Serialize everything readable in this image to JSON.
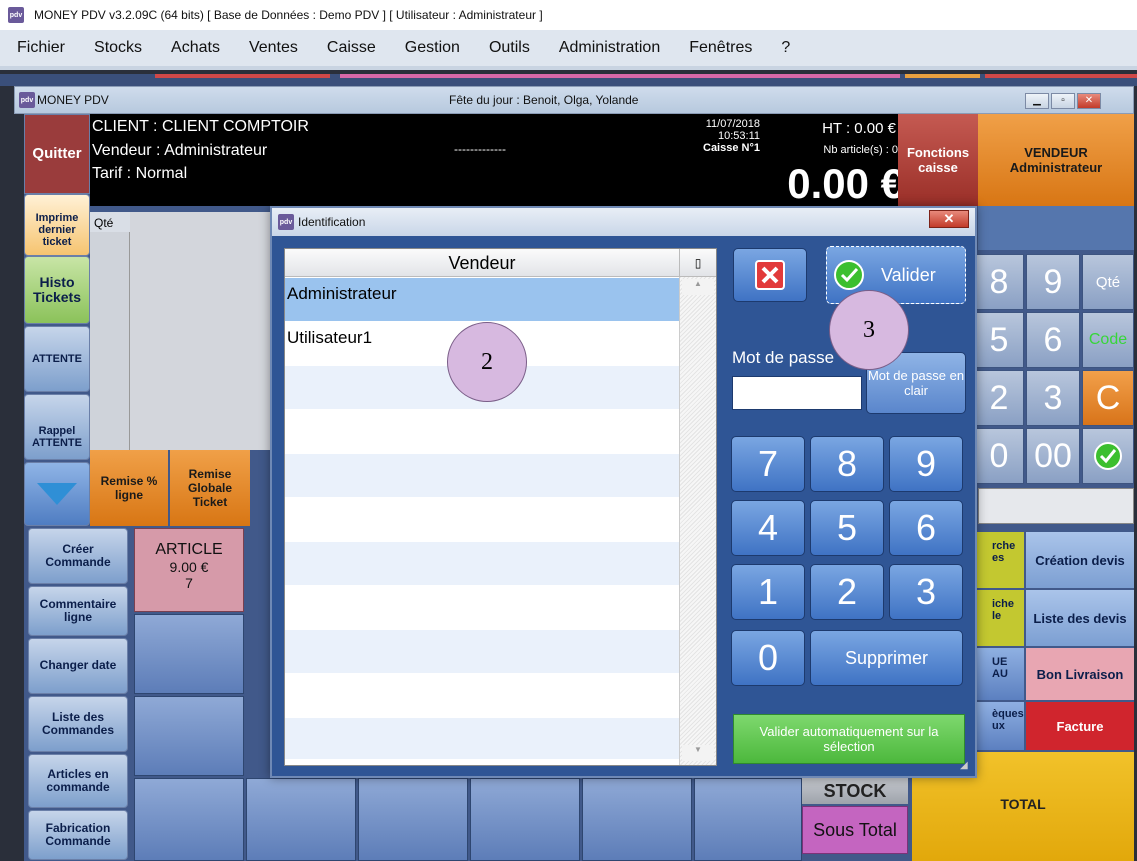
{
  "titlebar": {
    "text": "MONEY PDV v3.2.09C (64 bits) [ Base de Données : Demo PDV ] [ Utilisateur : Administrateur ]"
  },
  "menu": [
    "Fichier",
    "Stocks",
    "Achats",
    "Ventes",
    "Caisse",
    "Gestion",
    "Outils",
    "Administration",
    "Fenêtres",
    "?"
  ],
  "inner_window": {
    "title": "MONEY PDV",
    "fete": "Fête du jour : Benoit, Olga, Yolande"
  },
  "header": {
    "client": "CLIENT : CLIENT COMPTOIR",
    "vendeur": "Vendeur : Administrateur",
    "tarif": "Tarif : Normal",
    "dashes": "-------------",
    "datetime": "11/07/2018 10:53:11",
    "caisse": "Caisse N°1",
    "ht": "HT : 0.00 €",
    "nb_articles": "Nb article(s) : 0",
    "total": "0.00 €"
  },
  "side": {
    "quitter": "Quitter",
    "imprime": "Imprime dernier ticket",
    "histo": "Histo Tickets",
    "attente": "ATTENTE",
    "rappel": "Rappel ATTENTE",
    "creer": "Créer Commande",
    "commentaire": "Commentaire ligne",
    "changer": "Changer date",
    "liste_cmd": "Liste des Commandes",
    "articles_cmd": "Articles en commande",
    "fabrication": "Fabrication Commande"
  },
  "ticket": {
    "qte_header": "Qté",
    "remise_ligne": "Remise % ligne",
    "remise_globale": "Remise Globale Ticket"
  },
  "article": {
    "name": "ARTICLE",
    "price": "9.00 €",
    "qty": "7"
  },
  "right": {
    "fonctions": "Fonctions caisse",
    "vendeur_label": "VENDEUR",
    "vendeur_name": "Administrateur",
    "keys_row1": [
      "8",
      "9",
      "Qté"
    ],
    "keys_row2": [
      "5",
      "6",
      "Code"
    ],
    "keys_row3": [
      "2",
      "3",
      "C"
    ],
    "keys_row4": [
      "0",
      "00"
    ],
    "creation_devis": "Création devis",
    "liste_devis": "Liste des devis",
    "bon_livraison": "Bon Livraison",
    "facture": "Facture",
    "total": "TOTAL",
    "sous_total": "Sous Total",
    "stock": "STOCK",
    "partial1": "rche es",
    "partial2": "iche le",
    "partial3": "UE AU",
    "partial4": "èques ux"
  },
  "dialog": {
    "title": "Identification",
    "column": "Vendeur",
    "users": [
      "Administrateur",
      "Utilisateur1"
    ],
    "valider": "Valider",
    "mdp_label": "Mot de passe",
    "mdp_clair": "Mot de passe en clair",
    "numpad": [
      "7",
      "8",
      "9",
      "4",
      "5",
      "6",
      "1",
      "2",
      "3",
      "0"
    ],
    "supprimer": "Supprimer",
    "auto": "Valider automatiquement sur la sélection"
  },
  "annotations": [
    "2",
    "3"
  ]
}
